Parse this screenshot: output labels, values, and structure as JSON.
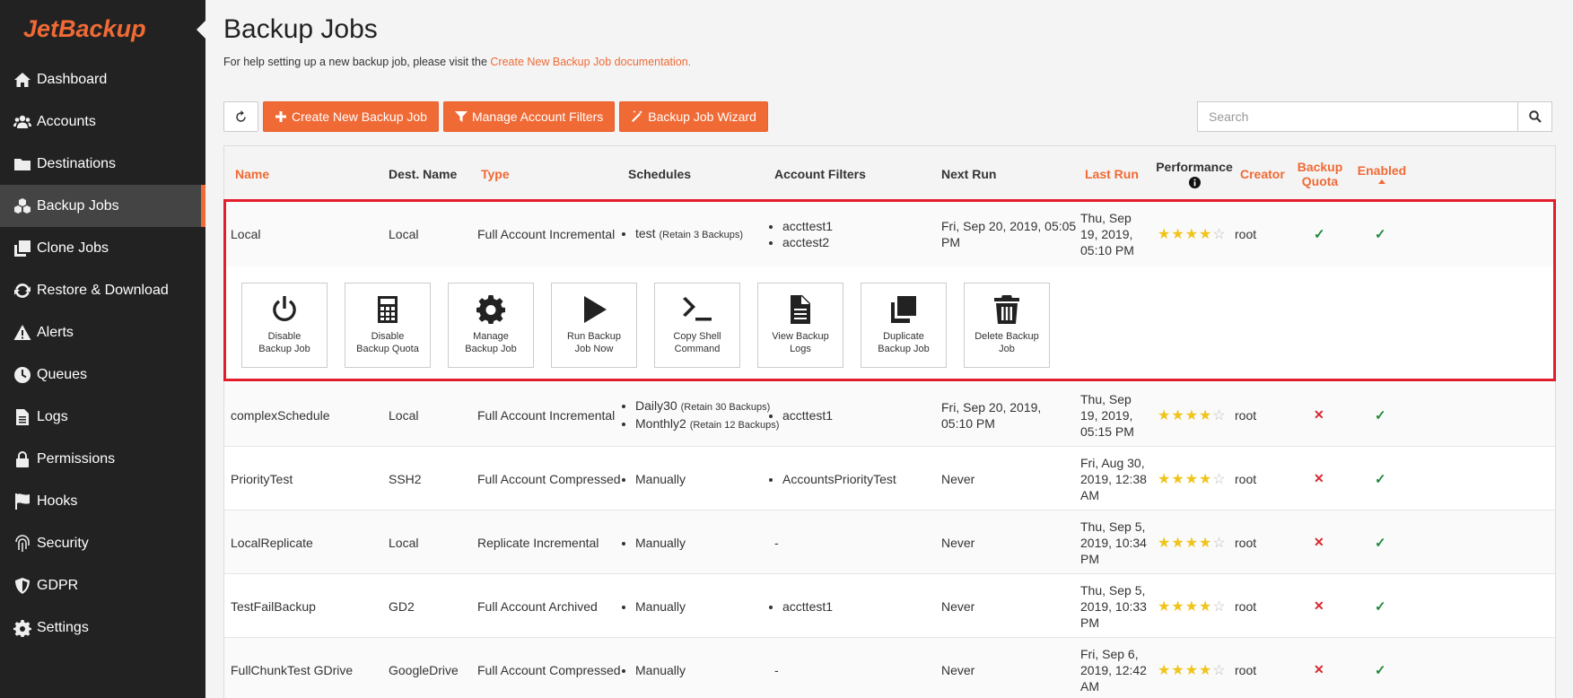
{
  "brand": {
    "name": "JetBackup",
    "accent": "#f06a35",
    "sidebar_bg": "#222222"
  },
  "sidebar": {
    "items": [
      {
        "label": "Dashboard",
        "icon": "home-icon"
      },
      {
        "label": "Accounts",
        "icon": "users-icon"
      },
      {
        "label": "Destinations",
        "icon": "folder-icon"
      },
      {
        "label": "Backup Jobs",
        "icon": "cubes-icon",
        "active": true
      },
      {
        "label": "Clone Jobs",
        "icon": "clone-icon"
      },
      {
        "label": "Restore & Download",
        "icon": "refresh-icon"
      },
      {
        "label": "Alerts",
        "icon": "warning-icon"
      },
      {
        "label": "Queues",
        "icon": "clock-icon"
      },
      {
        "label": "Logs",
        "icon": "file-icon"
      },
      {
        "label": "Permissions",
        "icon": "lock-icon"
      },
      {
        "label": "Hooks",
        "icon": "flag-icon"
      },
      {
        "label": "Security",
        "icon": "fingerprint-icon"
      },
      {
        "label": "GDPR",
        "icon": "shield-icon"
      },
      {
        "label": "Settings",
        "icon": "gear-icon"
      }
    ]
  },
  "header": {
    "title": "Backup Jobs",
    "help_prefix": "For help setting up a new backup job, please visit the ",
    "help_link": "Create New Backup Job documentation."
  },
  "toolbar": {
    "create_label": "Create New Backup Job",
    "filters_label": "Manage Account Filters",
    "wizard_label": "Backup Job Wizard"
  },
  "search": {
    "placeholder": "Search",
    "value": ""
  },
  "table": {
    "columns": {
      "name": "Name",
      "dest": "Dest. Name",
      "type": "Type",
      "schedules": "Schedules",
      "filters": "Account Filters",
      "next_run": "Next Run",
      "last_run": "Last Run",
      "performance": "Performance",
      "creator": "Creator",
      "quota_1": "Backup",
      "quota_2": "Quota",
      "enabled": "Enabled"
    },
    "rows": [
      {
        "name": "Local",
        "dest": "Local",
        "type": "Full Account Incremental",
        "schedules": [
          {
            "name": "test",
            "retain": "(Retain 3 Backups)"
          }
        ],
        "filters": [
          "accttest1",
          "acctest2"
        ],
        "next_run": "Fri, Sep 20, 2019, 05:05 PM",
        "last_run": "Thu, Sep 19, 2019, 05:10 PM",
        "rating": 4,
        "creator": "root",
        "quota": true,
        "enabled": true
      },
      {
        "name": "complexSchedule",
        "dest": "Local",
        "type": "Full Account Incremental",
        "schedules": [
          {
            "name": "Daily30",
            "retain": "(Retain 30 Backups)"
          },
          {
            "name": "Monthly2",
            "retain": "(Retain 12 Backups)"
          }
        ],
        "filters": [
          "accttest1"
        ],
        "next_run": "Fri, Sep 20, 2019, 05:10 PM",
        "last_run": "Thu, Sep 19, 2019, 05:15 PM",
        "rating": 4,
        "creator": "root",
        "quota": false,
        "enabled": true
      },
      {
        "name": "PriorityTest",
        "dest": "SSH2",
        "type": "Full Account Compressed",
        "schedules": [
          {
            "name": "Manually",
            "retain": ""
          }
        ],
        "filters": [
          "AccountsPriorityTest"
        ],
        "next_run": "Never",
        "last_run": "Fri, Aug 30, 2019, 12:38 AM",
        "rating": 4,
        "creator": "root",
        "quota": false,
        "enabled": true
      },
      {
        "name": "LocalReplicate",
        "dest": "Local",
        "type": "Replicate Incremental",
        "schedules": [
          {
            "name": "Manually",
            "retain": ""
          }
        ],
        "filters_text": "-",
        "next_run": "Never",
        "last_run": "Thu, Sep 5, 2019, 10:34 PM",
        "rating": 4,
        "creator": "root",
        "quota": false,
        "enabled": true
      },
      {
        "name": "TestFailBackup",
        "dest": "GD2",
        "type": "Full Account Archived",
        "schedules": [
          {
            "name": "Manually",
            "retain": ""
          }
        ],
        "filters": [
          "accttest1"
        ],
        "next_run": "Never",
        "last_run": "Thu, Sep 5, 2019, 10:33 PM",
        "rating": 4,
        "creator": "root",
        "quota": false,
        "enabled": true
      },
      {
        "name": "FullChunkTest GDrive",
        "dest": "GoogleDrive",
        "type": "Full Account Compressed",
        "schedules": [
          {
            "name": "Manually",
            "retain": ""
          }
        ],
        "filters_text": "-",
        "next_run": "Never",
        "last_run": "Fri, Sep 6, 2019, 12:42 AM",
        "rating": 4,
        "creator": "root",
        "quota": false,
        "enabled": true
      }
    ]
  },
  "actions": [
    {
      "label_1": "Disable",
      "label_2": "Backup Job",
      "icon": "power-icon"
    },
    {
      "label_1": "Disable",
      "label_2": "Backup Quota",
      "icon": "calculator-icon"
    },
    {
      "label_1": "Manage",
      "label_2": "Backup Job",
      "icon": "gear-icon"
    },
    {
      "label_1": "Run Backup",
      "label_2": "Job Now",
      "icon": "play-icon"
    },
    {
      "label_1": "Copy Shell",
      "label_2": "Command",
      "icon": "terminal-icon"
    },
    {
      "label_1": "View Backup",
      "label_2": "Logs",
      "icon": "file-text-icon"
    },
    {
      "label_1": "Duplicate",
      "label_2": "Backup Job",
      "icon": "copy-icon"
    },
    {
      "label_1": "Delete Backup",
      "label_2": "Job",
      "icon": "trash-icon"
    }
  ]
}
